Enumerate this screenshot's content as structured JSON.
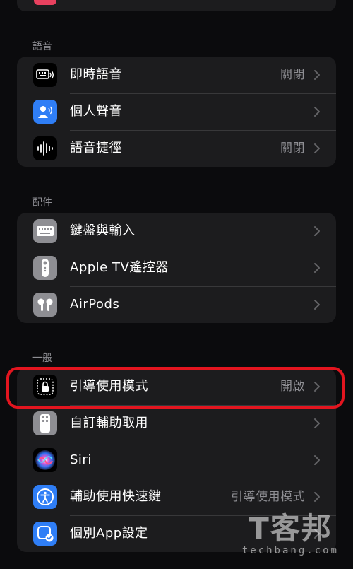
{
  "sections": {
    "speech": {
      "header": "語音",
      "rows": [
        {
          "label": "即時語音",
          "value": "關閉"
        },
        {
          "label": "個人聲音",
          "value": ""
        },
        {
          "label": "語音捷徑",
          "value": "關閉"
        }
      ]
    },
    "accessories": {
      "header": "配件",
      "rows": [
        {
          "label": "鍵盤與輸入",
          "value": ""
        },
        {
          "label": "Apple TV遙控器",
          "value": ""
        },
        {
          "label": "AirPods",
          "value": ""
        }
      ]
    },
    "general": {
      "header": "一般",
      "rows": [
        {
          "label": "引導使用模式",
          "value": "開啟"
        },
        {
          "label": "自訂輔助取用",
          "value": ""
        },
        {
          "label": "Siri",
          "value": ""
        },
        {
          "label": "輔助使用快速鍵",
          "value": "引導使用模式"
        },
        {
          "label": "個別App設定",
          "value": ""
        }
      ]
    }
  },
  "watermark": {
    "main": "T客邦",
    "sub": "techbang.com"
  },
  "colors": {
    "background": "#0b0b0d",
    "group": "#1c1c1e",
    "secondary_text": "#8e8e93",
    "highlight": "#e3151f",
    "accent_blue": "#2f7ef6"
  }
}
